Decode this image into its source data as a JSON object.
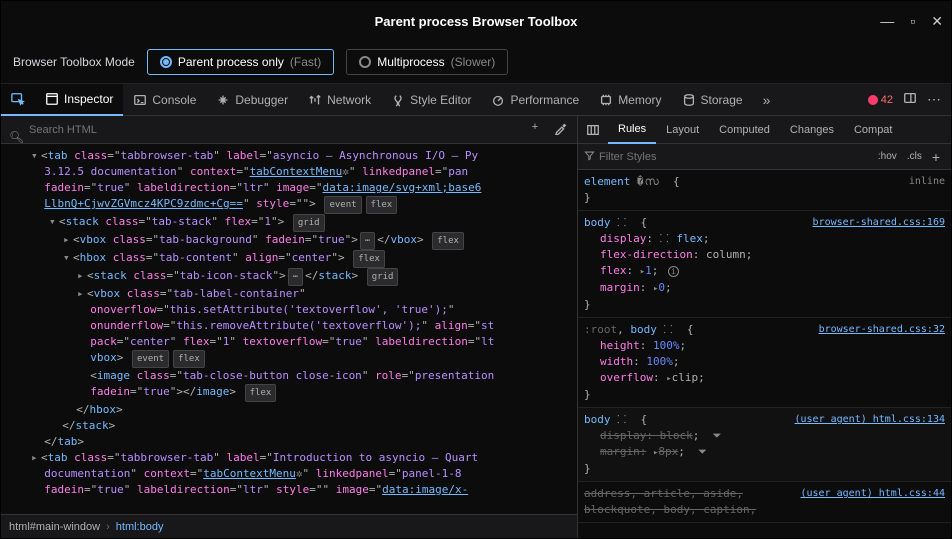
{
  "window": {
    "title": "Parent process Browser Toolbox"
  },
  "mode_bar": {
    "label": "Browser Toolbox Mode",
    "opt1": {
      "text": "Parent process only",
      "hint": "(Fast)"
    },
    "opt2": {
      "text": "Multiprocess",
      "hint": "(Slower)"
    }
  },
  "toolbar": {
    "inspector": "Inspector",
    "console": "Console",
    "debugger": "Debugger",
    "network": "Network",
    "style_editor": "Style Editor",
    "performance": "Performance",
    "memory": "Memory",
    "storage": "Storage",
    "error_count": "42"
  },
  "search": {
    "placeholder": "Search HTML"
  },
  "breadcrumb": {
    "c1": "html#main-window",
    "c2": "html:body"
  },
  "right_tabs": {
    "rules": "Rules",
    "layout": "Layout",
    "computed": "Computed",
    "changes": "Changes",
    "compat": "Compat"
  },
  "filter": {
    "placeholder": "Filter Styles",
    "hov": ":hov",
    "cls": ".cls"
  },
  "rules_panel": {
    "element": "element",
    "inline": "inline",
    "body": "body",
    "root": ":root",
    "src1": "browser-shared.css:169",
    "src2": "browser-shared.css:32",
    "src3": "(user agent) html.css:134",
    "src4": "(user agent) html.css:44",
    "display": "display",
    "flex": "flex",
    "flex_direction": "flex-direction",
    "column": "column",
    "flex_prop": "flex",
    "flex_val": "1",
    "margin": "margin",
    "zero": "0",
    "height": "height",
    "hundred": "100%",
    "width": "width",
    "overflow": "overflow",
    "clip": "clip",
    "display_block": "display: block",
    "margin_8": "margin:",
    "eight": "8px",
    "addr_line": "address, article, aside,",
    "block_line": "blockquote, body, caption,"
  },
  "dom": {
    "l0": {
      "cls": "tabbrowser-tab",
      "lbl": "asyncio — Asynchronous I/O — Py",
      "doc": "3.12.5 documentation",
      "ctx": "tabContextMenu",
      "lp": "linkedpanel",
      "pan": "pan",
      "fade": "fadein",
      "tr": "true",
      "ld": "labeldirection",
      "ltr": "ltr",
      "img": "image",
      "data": "data:image/svg+xml;base6",
      "b64": "LlbnQ+CjwvZGVmcz4KPC9zdmc+Cg==",
      "sty": "style"
    },
    "stack": {
      "cls": "tab-stack",
      "flex": "1"
    },
    "vbox": {
      "cls": "tab-background",
      "tr": "true"
    },
    "hbox": {
      "cls": "tab-content",
      "al": "center"
    },
    "istack": {
      "cls": "tab-icon-stack"
    },
    "lblc": {
      "cls": "tab-label-container",
      "ovf": "this.setAttribute('textoverflow', 'true');",
      "und": "this.removeAttribute('textoverflow');",
      "al": "st",
      "pk": "center",
      "fx": "1",
      "to": "true",
      "ld": "lt"
    },
    "img": {
      "cls": "tab-close-button close-icon",
      "role": "presentation",
      "tr": "true"
    },
    "l2": {
      "cls": "tabbrowser-tab",
      "lbl": "Introduction to asyncio — Quart",
      "doc": "documentation",
      "ctx": "tabContextMenu",
      "lp": "linkedpanel",
      "pan": "panel-1-8",
      "tr": "true",
      "ld": "ltr",
      "sty": "",
      "data": "data:image/x-"
    },
    "close_hbox": "hbox",
    "close_stack": "stack",
    "close_tab": "tab",
    "badges": {
      "event": "event",
      "flex": "flex",
      "grid": "grid",
      "dots": "⋯"
    }
  }
}
